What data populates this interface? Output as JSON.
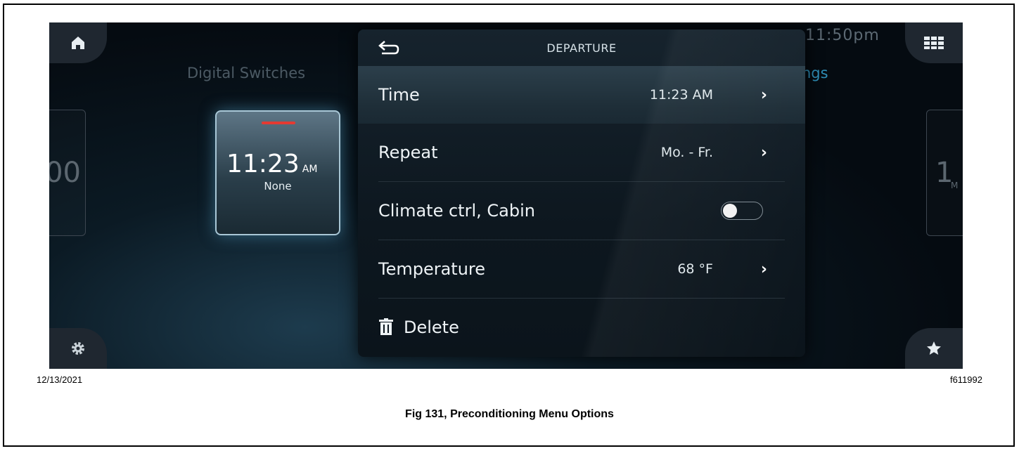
{
  "screen": {
    "clock": "11:50pm",
    "background_left_label": "Digital Switches",
    "background_right_label": "ngs",
    "side_left_text": "00",
    "side_right_text": "1",
    "side_right_sub": "M"
  },
  "card": {
    "time": "11:23",
    "ampm": "AM",
    "status": "None"
  },
  "panel": {
    "title": "DEPARTURE",
    "rows": [
      {
        "label": "Time",
        "value": "11:23 AM"
      },
      {
        "label": "Repeat",
        "value": "Mo. - Fr."
      },
      {
        "label": "Climate ctrl, Cabin",
        "toggle_on": false
      },
      {
        "label": "Temperature",
        "value": "68 °F"
      },
      {
        "label": "Delete"
      }
    ]
  },
  "figure": {
    "date": "12/13/2021",
    "id": "f611992",
    "caption": "Fig 131, Preconditioning Menu Options"
  },
  "colors": {
    "accent_red": "#e53a32",
    "accent_blue": "#2f8fb8"
  },
  "icons": [
    "home-icon",
    "apps-grid-icon",
    "settings-gear-icon",
    "favorite-star-icon",
    "back-arrow-icon",
    "chevron-right-icon",
    "trash-icon"
  ]
}
